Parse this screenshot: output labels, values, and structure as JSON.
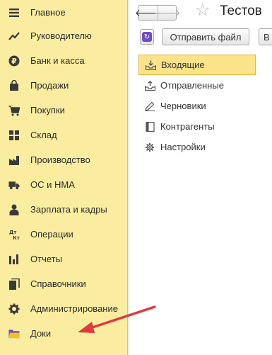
{
  "sidebar": {
    "items": [
      {
        "label": "Главное",
        "icon": "menu-lines-icon"
      },
      {
        "label": "Руководителю",
        "icon": "trend-chart-icon"
      },
      {
        "label": "Банк и касса",
        "icon": "ruble-coin-icon"
      },
      {
        "label": "Продажи",
        "icon": "shopping-bag-icon"
      },
      {
        "label": "Покупки",
        "icon": "cart-icon"
      },
      {
        "label": "Склад",
        "icon": "warehouse-grid-icon"
      },
      {
        "label": "Производство",
        "icon": "factory-icon"
      },
      {
        "label": "ОС и НМА",
        "icon": "truck-icon"
      },
      {
        "label": "Зарплата и кадры",
        "icon": "person-icon"
      },
      {
        "label": "Операции",
        "icon": "debit-credit-icon"
      },
      {
        "label": "Отчеты",
        "icon": "bar-chart-icon"
      },
      {
        "label": "Справочники",
        "icon": "books-icon"
      },
      {
        "label": "Администрирование",
        "icon": "gear-icon"
      },
      {
        "label": "Доки",
        "icon": "folder-icon"
      }
    ]
  },
  "header": {
    "title": "Тестов"
  },
  "toolbar": {
    "send_label": "Отправить файл",
    "cut_label": "В"
  },
  "folders": [
    {
      "label": "Входящие",
      "icon": "inbox-icon",
      "active": true
    },
    {
      "label": "Отправленные",
      "icon": "outbox-icon",
      "active": false
    },
    {
      "label": "Черновики",
      "icon": "pencil-icon",
      "active": false
    },
    {
      "label": "Контрагенты",
      "icon": "book-icon",
      "active": false
    },
    {
      "label": "Настройки",
      "icon": "gear-icon",
      "active": false
    }
  ],
  "colors": {
    "sidebar_bg": "#fbeda0",
    "active_folder_bg": "#fbe38a",
    "arrow": "#e0393e",
    "accent_purple": "#6d4ec7"
  }
}
